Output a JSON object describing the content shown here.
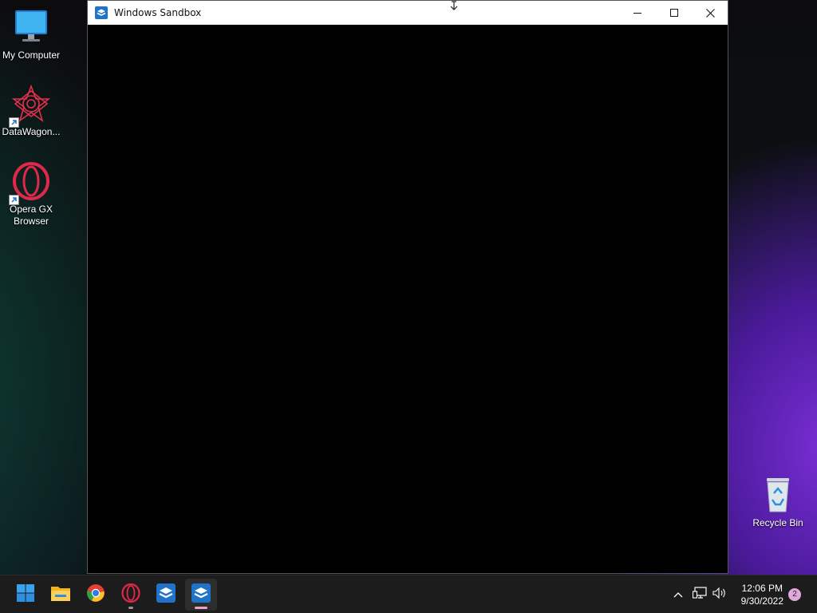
{
  "desktop": {
    "icons": [
      {
        "label": "My Computer",
        "icon": "monitor-icon"
      },
      {
        "label": "DataWagon...",
        "icon": "datawagon-icon"
      },
      {
        "label": "Opera GX Browser",
        "icon": "opera-gx-icon"
      },
      {
        "label": "Recycle Bin",
        "icon": "recycle-bin-icon"
      }
    ]
  },
  "window": {
    "title": "Windows Sandbox",
    "icon": "sandbox-icon",
    "controls": [
      "minimize",
      "maximize",
      "close"
    ]
  },
  "taskbar": {
    "apps": [
      {
        "name": "Start",
        "icon": "windows-start-icon"
      },
      {
        "name": "File Explorer",
        "icon": "folder-icon"
      },
      {
        "name": "Google Chrome",
        "icon": "chrome-icon"
      },
      {
        "name": "Opera GX",
        "icon": "opera-gx-icon"
      },
      {
        "name": "Windows Sandbox",
        "icon": "sandbox-icon"
      },
      {
        "name": "Windows Sandbox",
        "icon": "sandbox-icon"
      }
    ],
    "tray": {
      "time": "12:06 PM",
      "date": "9/30/2022",
      "notifications": "2"
    }
  },
  "colors": {
    "sandbox_blue": "#1f73c9",
    "opera_red": "#e0284a",
    "taskbar_bg": "#1c1c1c"
  }
}
